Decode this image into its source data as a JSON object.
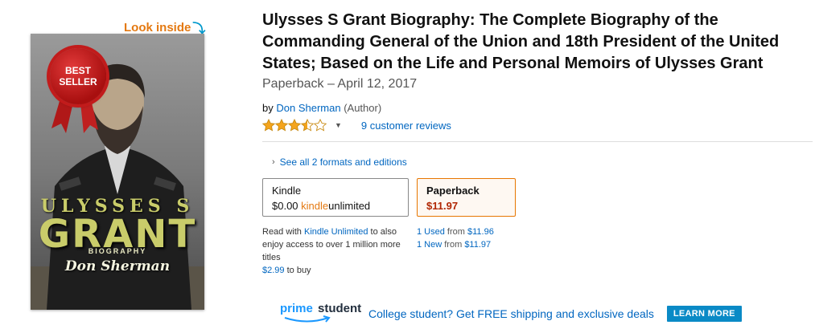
{
  "cover": {
    "look_inside": "Look inside",
    "badge_line1": "BEST",
    "badge_line2": "SELLER",
    "cover_title_top": "ULYSSES S",
    "cover_title_main": "GRANT",
    "cover_subtitle": "BIOGRAPHY",
    "cover_author": "Don Sherman"
  },
  "product": {
    "title": "Ulysses S Grant Biography: The Complete Biography of the Commanding General of the Union and 18th President of the United States; Based on the Life and Personal Memoirs of Ulysses Grant",
    "format_date": "Paperback – April 12, 2017",
    "by_prefix": "by",
    "author": "Don Sherman",
    "author_role": "(Author)",
    "rating": 3.5,
    "rating_max": 5,
    "reviews_label": "9 customer reviews",
    "star_color": "#f4a41c"
  },
  "formats": {
    "see_all": "See all 2 formats and editions",
    "kindle": {
      "name": "Kindle",
      "price": "$0.00",
      "ku_kindle": "kindle",
      "ku_unlimited": "unlimited"
    },
    "paperback": {
      "name": "Paperback",
      "price": "$11.97"
    }
  },
  "kindle_note": {
    "read_with": "Read with",
    "ku_link": "Kindle Unlimited",
    "rest": "to also enjoy access to over 1 million more titles",
    "price": "$2.99",
    "to_buy": "to buy"
  },
  "offers": {
    "used_count": "1 Used",
    "used_from": "from",
    "used_price": "$11.96",
    "new_count": "1 New",
    "new_from": "from",
    "new_price": "$11.97"
  },
  "prime_student": {
    "logo_prime": "prime",
    "logo_student": "student",
    "message": "College student? Get FREE shipping and exclusive deals",
    "button": "LEARN MORE"
  }
}
